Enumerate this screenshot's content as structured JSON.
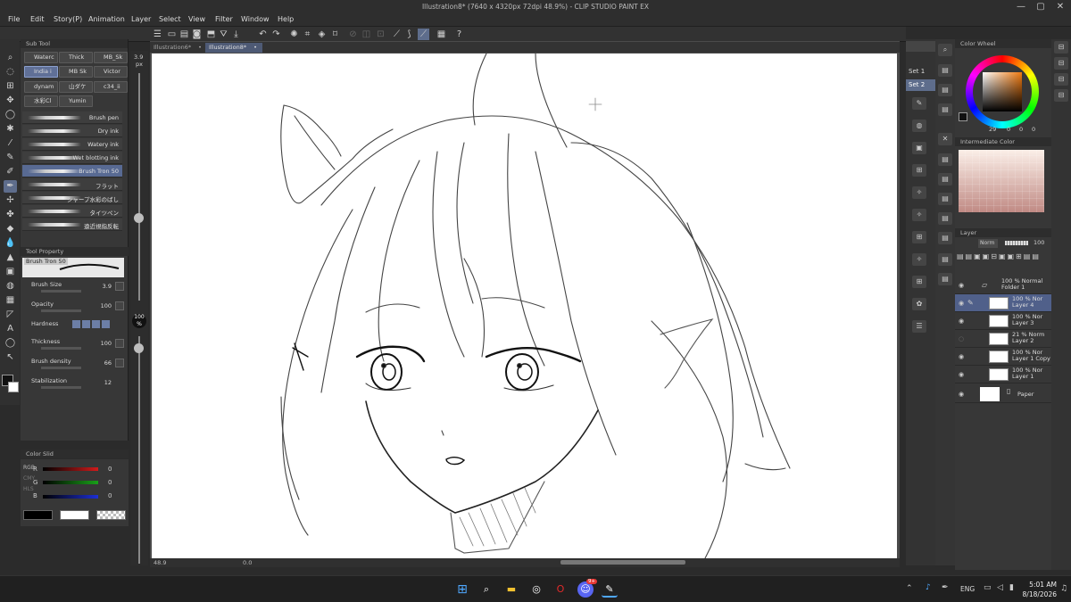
{
  "window": {
    "title": "Illustration8* (7640 x 4320px 72dpi 48.9%)  - CLIP STUDIO PAINT EX",
    "min": "—",
    "max": "▢",
    "close": "✕"
  },
  "menu": [
    "File",
    "Edit",
    "Story(P)",
    "Animation",
    "Layer",
    "Select",
    "View",
    "Filter",
    "Window",
    "Help"
  ],
  "tabs": [
    {
      "label": "Illustration6*",
      "active": false
    },
    {
      "label": "Illustration8*",
      "active": true
    }
  ],
  "subtool": {
    "header": "Sub Tool",
    "chips": [
      "Waterc",
      "Thick",
      "MB_Sk",
      "India i",
      "MB Sk",
      "Victor",
      "dynam",
      "山ダケ",
      "c34_ii",
      "水彩Cl",
      "Yumin"
    ],
    "selected_chip": "India i",
    "brushes": [
      "Brush pen",
      "Dry ink",
      "Watery ink",
      "Wet blotting ink",
      "Brush Tron 50",
      "フラット",
      "シャープ水彩のばし",
      "タイツペン",
      "遠近視指反転"
    ],
    "selected_brush": "Brush Tron 50"
  },
  "tool_property": {
    "header": "Tool Property",
    "brush_name": "Brush Tron 50",
    "props": [
      {
        "label": "Brush Size",
        "value": "3.9"
      },
      {
        "label": "Opacity",
        "value": "100"
      },
      {
        "label": "Hardness",
        "value": ""
      },
      {
        "label": "Thickness",
        "value": "100"
      },
      {
        "label": "Brush density",
        "value": "66"
      },
      {
        "label": "Stabilization",
        "value": "12"
      }
    ]
  },
  "color_slider": {
    "header": "Color Slid",
    "mode_labels": [
      "RGB",
      "CMY",
      "HLS"
    ],
    "channels": [
      {
        "label": "R",
        "value": "0",
        "color": "#d11b1b"
      },
      {
        "label": "G",
        "value": "0",
        "color": "#19a019"
      },
      {
        "label": "B",
        "value": "0",
        "color": "#1d2fd4"
      }
    ]
  },
  "size_indicator": {
    "size": "3.9",
    "unit": "px",
    "opacity": "100",
    "opacity_unit": "%"
  },
  "statusbar": {
    "zoom": "48.9",
    "angle": "0.0"
  },
  "right_sets": [
    "Set 1",
    "Set 2"
  ],
  "color_wheel": {
    "header": "Color Wheel",
    "v1": "29",
    "v2": "0",
    "v3": "0",
    "v4": "0"
  },
  "intermediate_color": {
    "header": "Intermediate Color"
  },
  "layer_panel": {
    "header": "Layer",
    "blend_mode": "Norm",
    "opacity": "100",
    "layers": [
      {
        "line1": "100 % Normal",
        "line2": "Folder 1",
        "folder": true,
        "selected": false
      },
      {
        "line1": "100 % Nor",
        "line2": "Layer 4",
        "folder": false,
        "selected": true
      },
      {
        "line1": "100 % Nor",
        "line2": "Layer 3",
        "folder": false,
        "selected": false
      },
      {
        "line1": "21 % Norm",
        "line2": "Layer 2",
        "folder": false,
        "selected": false
      },
      {
        "line1": "100 % Nor",
        "line2": "Layer 1 Copy",
        "folder": false,
        "selected": false
      },
      {
        "line1": "100 % Nor",
        "line2": "Layer 1",
        "folder": false,
        "selected": false
      },
      {
        "line1": "",
        "line2": "Paper",
        "folder": false,
        "selected": false
      }
    ]
  },
  "taskbar": {
    "badge": "9+",
    "lang": "ENG",
    "time": "5:01 AM",
    "date": "8/18/2026"
  }
}
